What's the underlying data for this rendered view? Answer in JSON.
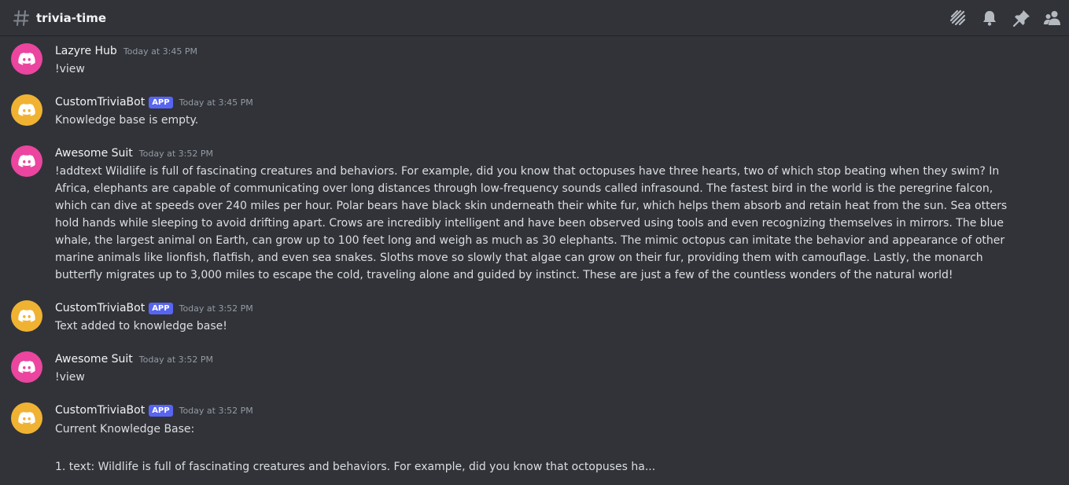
{
  "channel": {
    "name": "trivia-time",
    "icons": [
      "hash-icon",
      "threads-icon",
      "bell-icon",
      "pin-icon",
      "members-icon"
    ]
  },
  "colors": {
    "background": "#313338",
    "app_badge": "#5865f2",
    "avatar_pink": "#eb459f",
    "avatar_yellow": "#f0b232"
  },
  "messages": [
    {
      "author": "Lazyre Hub",
      "badge": "",
      "time": "Today at 3:45 PM",
      "text": "!view"
    },
    {
      "author": "CustomTriviaBot",
      "badge": "APP",
      "time": "Today at 3:45 PM",
      "text": "Knowledge base is empty."
    },
    {
      "author": "Awesome Suit",
      "badge": "",
      "time": "Today at 3:52 PM",
      "text": "!addtext Wildlife is full of fascinating creatures and behaviors. For example, did you know that octopuses have three hearts, two of which stop beating when they swim? In Africa, elephants are capable of communicating over long distances through low-frequency sounds called infrasound. The fastest bird in the world is the peregrine falcon, which can dive at speeds over 240 miles per hour. Polar bears have black skin underneath their white fur, which helps them absorb and retain heat from the sun. Sea otters hold hands while sleeping to avoid drifting apart. Crows are incredibly intelligent and have been observed using tools and even recognizing themselves in mirrors. The blue whale, the largest animal on Earth, can grow up to 100 feet long and weigh as much as 30 elephants. The mimic octopus can imitate the behavior and appearance of other marine animals like lionfish, flatfish, and even sea snakes. Sloths move so slowly that algae can grow on their fur, providing them with camouflage. Lastly, the monarch butterfly migrates up to 3,000 miles to escape the cold, traveling alone and guided by instinct. These are just a few of the countless wonders of the natural world!"
    },
    {
      "author": "CustomTriviaBot",
      "badge": "APP",
      "time": "Today at 3:52 PM",
      "text": "Text added to knowledge base!"
    },
    {
      "author": "Awesome Suit",
      "badge": "",
      "time": "Today at 3:52 PM",
      "text": "!view"
    },
    {
      "author": "CustomTriviaBot",
      "badge": "APP",
      "time": "Today at 3:52 PM",
      "text": "Current Knowledge Base:\n\n1. text: Wildlife is full of fascinating creatures and behaviors. For example, did you know that octopuses ha..."
    }
  ]
}
